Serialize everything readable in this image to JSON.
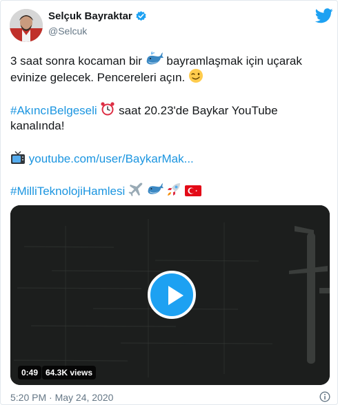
{
  "author": {
    "name": "Selçuk Bayraktar",
    "handle": "@Selcuk"
  },
  "tweet": {
    "line1_a": "3 saat sonra kocaman bir",
    "line1_b": "bayramlaşmak için uçarak",
    "line2": "evinize gelecek. Pencereleri açın.",
    "hashtag1": "#AkıncıBelgeseli",
    "line3_rest": "saat 20.23'de Baykar YouTube",
    "line4": "kanalında!",
    "link": "youtube.com/user/BaykarMak...",
    "hashtag2": "#MilliTeknolojiHamlesi"
  },
  "video": {
    "duration": "0:49",
    "views": "64.3K views"
  },
  "footer": {
    "timestamp": "5:20 PM · May 24, 2020"
  },
  "icons": {
    "twitter_bird": "twitter-bird-icon",
    "verified": "verified-badge-icon",
    "info": "info-icon"
  },
  "colors": {
    "accent": "#1da1f2",
    "link": "#1b95e0",
    "secondary_text": "#657786"
  }
}
